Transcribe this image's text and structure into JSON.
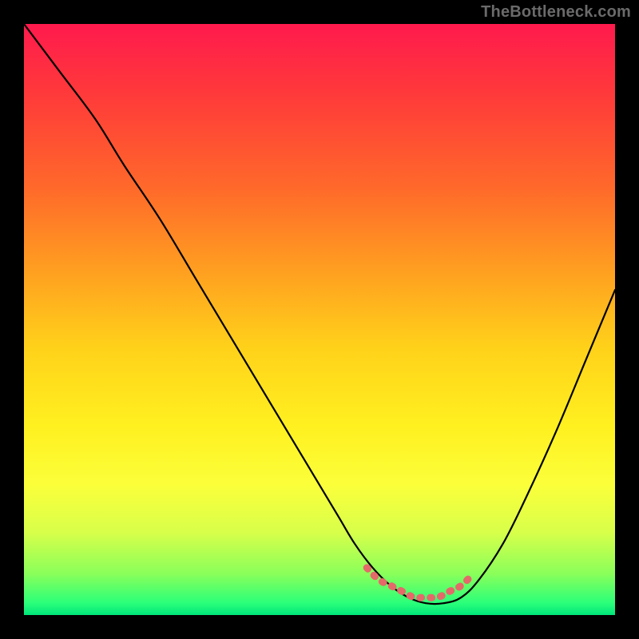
{
  "watermark": "TheBottleneck.com",
  "colors": {
    "page_bg": "#000000",
    "curve_stroke": "#000000",
    "polyfit_stroke": "#e46a6a",
    "gradient_top": "#ff1a4d",
    "gradient_bottom": "#00e67a"
  },
  "chart_data": {
    "type": "line",
    "title": "",
    "xlabel": "",
    "ylabel": "",
    "xlim": [
      0,
      100
    ],
    "ylim": [
      0,
      100
    ],
    "grid": false,
    "legend": null,
    "series": [
      {
        "name": "bottleneck-curve",
        "x": [
          0,
          6,
          12,
          17,
          23,
          29,
          35,
          41,
          47,
          53,
          56,
          59,
          62,
          65,
          68,
          71,
          74,
          77,
          81,
          85,
          90,
          95,
          100
        ],
        "y": [
          100,
          92,
          84,
          76,
          67,
          57,
          47,
          37,
          27,
          17,
          12,
          8,
          5,
          3,
          2,
          2,
          3,
          6,
          12,
          20,
          31,
          43,
          55
        ]
      },
      {
        "name": "bottom-polyfit-segment",
        "x": [
          58,
          60,
          62,
          64,
          66,
          68,
          70,
          72,
          74,
          76
        ],
        "y": [
          8,
          6,
          5,
          4,
          3,
          3,
          3,
          4,
          5,
          7
        ]
      }
    ],
    "annotations": []
  }
}
